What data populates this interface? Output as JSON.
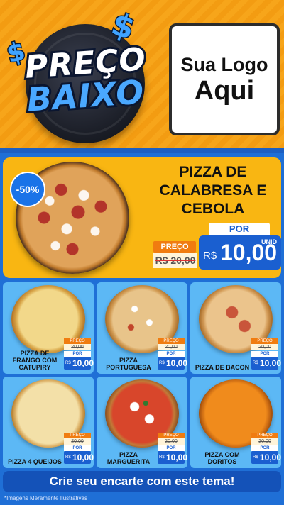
{
  "header": {
    "badge_line1": "PREÇO",
    "badge_line2": "BAIXO",
    "logo_line1": "Sua Logo",
    "logo_line2": "Aqui"
  },
  "hero": {
    "title": "PIZZA DE CALABRESA E CEBOLA",
    "discount": "-50%",
    "old_label": "PREÇO",
    "old_price": "R$ 20,00",
    "new_label": "POR",
    "currency": "R$",
    "new_price": "10,00",
    "unit": "UNID"
  },
  "products": [
    {
      "name": "PIZZA DE FRANGO COM CATUPIRY",
      "old_price": "20,00",
      "new_price": "10,00"
    },
    {
      "name": "PIZZA PORTUGUESA",
      "old_price": "20,00",
      "new_price": "10,00"
    },
    {
      "name": "PIZZA DE BACON",
      "old_price": "20,00",
      "new_price": "10,00"
    },
    {
      "name": "PIZZA 4 QUEIJOS",
      "old_price": "20,00",
      "new_price": "10,00"
    },
    {
      "name": "PIZZA MARGUERITA",
      "old_price": "20,00",
      "new_price": "10,00"
    },
    {
      "name": "PIZZA COM DORITOS",
      "old_price": "20,00",
      "new_price": "10,00"
    }
  ],
  "labels": {
    "old": "PREÇO",
    "por": "POR",
    "currency": "R$"
  },
  "footer": {
    "cta": "Crie seu encarte com este tema!",
    "disclaimer": "*Imagens Meramente Ilustrativas"
  },
  "colors": {
    "header_bg": "#f7a51a",
    "page_bg": "#1f6fd6",
    "hero_bg": "#f9b612",
    "card_bg": "#5cb8f5",
    "price_blue": "#1a5fd0",
    "old_orange": "#f07c10"
  }
}
